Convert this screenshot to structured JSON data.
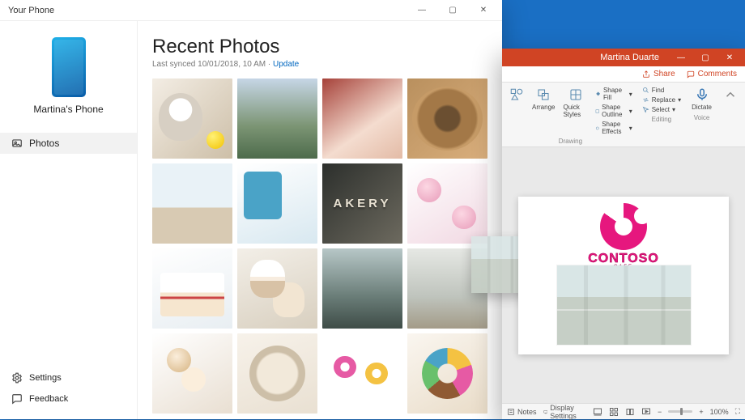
{
  "yourphone": {
    "window_title": "Your Phone",
    "device_name": "Martina's Phone",
    "nav": {
      "photos": "Photos",
      "settings": "Settings",
      "feedback": "Feedback"
    },
    "main": {
      "heading": "Recent Photos",
      "sync_prefix": "Last synced 10/01/2018, 10 AM · ",
      "update_link": "Update"
    },
    "window_controls": {
      "minimize": "—",
      "maximize": "▢",
      "close": "✕"
    }
  },
  "powerpoint": {
    "user_name": "Martina Duarte",
    "window_controls": {
      "minimize": "—",
      "maximize": "▢",
      "close": "✕"
    },
    "topbar": {
      "share": "Share",
      "comments": "Comments"
    },
    "ribbon": {
      "arrange": "Arrange",
      "quick_styles": "Quick Styles",
      "shape_fill": "Shape Fill",
      "shape_outline": "Shape Outline",
      "shape_effects": "Shape Effects",
      "drawing_group": "Drawing",
      "find": "Find",
      "replace": "Replace",
      "select": "Select",
      "editing_group": "Editing",
      "dictate": "Dictate",
      "voice_group": "Voice"
    },
    "slide": {
      "brand": "CONTOSO",
      "brand_sub": "CAFE"
    },
    "status": {
      "notes": "Notes",
      "display_settings": "Display Settings",
      "zoom_minus": "−",
      "zoom_plus": "+",
      "zoom_value": "100%",
      "fit": "⛶"
    }
  }
}
